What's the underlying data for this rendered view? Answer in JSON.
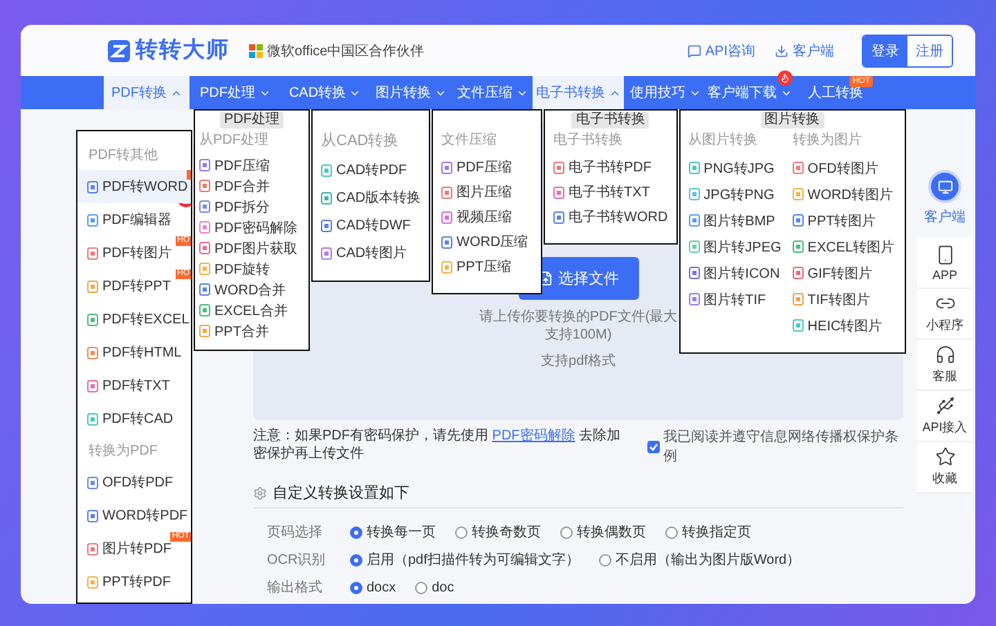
{
  "header": {
    "brand": "转转大师",
    "partner": "微软office中国区合作伙伴",
    "links": [
      {
        "label": "API咨询",
        "kind": "chat"
      },
      {
        "label": "客户端",
        "kind": "download"
      }
    ],
    "buttons": [
      {
        "label": "登录",
        "selected": true
      },
      {
        "label": "注册",
        "selected": false
      }
    ]
  },
  "nav": [
    {
      "label": "PDF转换",
      "kind": "menu",
      "selected": true,
      "expanded": true
    },
    {
      "label": "PDF处理",
      "kind": "menu",
      "selected": false,
      "expanded": false
    },
    {
      "label": "CAD转换",
      "kind": "menu",
      "selected": false,
      "expanded": false
    },
    {
      "label": "图片转换",
      "kind": "menu",
      "selected": false,
      "expanded": false
    },
    {
      "label": "文件压缩",
      "kind": "menu",
      "selected": false,
      "expanded": false
    },
    {
      "label": "电子书转换",
      "kind": "menu",
      "selected": true,
      "expanded": true
    },
    {
      "label": "使用技巧",
      "kind": "menu",
      "selected": false,
      "expanded": false
    },
    {
      "label": "客户端下载",
      "kind": "download",
      "selected": false,
      "expanded": false
    },
    {
      "label": "人工转换",
      "kind": "link",
      "selected": false,
      "badge": "HOT"
    }
  ],
  "menus": [
    {
      "kind": "side",
      "home_badge": true,
      "sections": [
        {
          "heading": "PDF转其他",
          "items": [
            {
              "label": "PDF转WORD",
              "color": "#5b83f0",
              "selected": true,
              "badge_sliver": true
            },
            {
              "label": "PDF编辑器",
              "color": "#5b9cf0",
              "selected": false
            },
            {
              "label": "PDF转图片",
              "color": "#f07a7a",
              "selected": false,
              "badge": "HO"
            },
            {
              "label": "PDF转PPT",
              "color": "#f5a84a",
              "selected": false,
              "badge": "HO"
            },
            {
              "label": "PDF转EXCEL",
              "color": "#4dbf7f",
              "selected": false
            },
            {
              "label": "PDF转HTML",
              "color": "#f58a5a",
              "selected": false
            },
            {
              "label": "PDF转TXT",
              "color": "#f06ab0",
              "selected": false
            },
            {
              "label": "PDF转CAD",
              "color": "#4cc7c0",
              "selected": false
            }
          ]
        },
        {
          "heading": "转换为PDF",
          "items": [
            {
              "label": "OFD转PDF",
              "color": "#6b8cf0",
              "selected": false
            },
            {
              "label": "WORD转PDF",
              "color": "#5b83f0",
              "selected": false
            },
            {
              "label": "图片转PDF",
              "color": "#f07a7a",
              "selected": false,
              "badge": "HOT"
            },
            {
              "label": "PPT转PDF",
              "color": "#f5b24a",
              "selected": false
            }
          ]
        }
      ]
    },
    {
      "kind": "compact",
      "tooltip": "PDF处理",
      "sections": [
        {
          "heading": "从PDF处理",
          "items": [
            {
              "label": "PDF压缩",
              "color": "#9a7cf0"
            },
            {
              "label": "PDF合并",
              "color": "#f07a6a"
            },
            {
              "label": "PDF拆分",
              "color": "#7a8cf0"
            },
            {
              "label": "PDF密码解除",
              "color": "#e08ad8"
            },
            {
              "label": "PDF图片获取",
              "color": "#f06a9a"
            },
            {
              "label": "PDF旋转",
              "color": "#f5b24a"
            },
            {
              "label": "WORD合并",
              "color": "#5b83f0"
            },
            {
              "label": "EXCEL合并",
              "color": "#4dbf7f"
            },
            {
              "label": "PPT合并",
              "color": "#f5a84a"
            }
          ]
        }
      ]
    },
    {
      "kind": "large",
      "sections": [
        {
          "heading": "从CAD转换",
          "items": [
            {
              "label": "CAD转PDF",
              "color": "#4cc7c0"
            },
            {
              "label": "CAD版本转换",
              "color": "#3fb8a8"
            },
            {
              "label": "CAD转DWF",
              "color": "#5b83f0"
            },
            {
              "label": "CAD转图片",
              "color": "#b07cf0"
            }
          ]
        }
      ]
    },
    {
      "kind": "regular",
      "sections": [
        {
          "heading": "文件压缩",
          "items": [
            {
              "label": "PDF压缩",
              "color": "#9a7cf0"
            },
            {
              "label": "图片压缩",
              "color": "#f07a7a"
            },
            {
              "label": "视频压缩",
              "color": "#e06ae0"
            },
            {
              "label": "WORD压缩",
              "color": "#5b83f0"
            },
            {
              "label": "PPT压缩",
              "color": "#f5b24a"
            }
          ]
        }
      ]
    },
    {
      "kind": "regular",
      "tooltip": "电子书转换",
      "sections": [
        {
          "heading": "电子书转换",
          "items": [
            {
              "label": "电子书转PDF",
              "color": "#f07a7a"
            },
            {
              "label": "电子书转TXT",
              "color": "#f06ab0"
            },
            {
              "label": "电子书转WORD",
              "color": "#5b83f0"
            }
          ]
        }
      ]
    },
    {
      "kind": "columns",
      "tooltip": "图片转换",
      "sections": [
        {
          "heading": "从图片转换",
          "items": [
            {
              "label": "PNG转JPG",
              "color": "#4cc7c0"
            },
            {
              "label": "JPG转PNG",
              "color": "#5bc7e0"
            },
            {
              "label": "图片转BMP",
              "color": "#5b9cf0"
            },
            {
              "label": "图片转JPEG",
              "color": "#6cd0b0"
            },
            {
              "label": "图片转ICON",
              "color": "#7a6cf0"
            },
            {
              "label": "图片转TIF",
              "color": "#a07cf0"
            }
          ]
        },
        {
          "heading": "转换为图片",
          "items": [
            {
              "label": "OFD转图片",
              "color": "#f07a7a"
            },
            {
              "label": "WORD转图片",
              "color": "#f5b24a"
            },
            {
              "label": "PPT转图片",
              "color": "#5b83f0"
            },
            {
              "label": "EXCEL转图片",
              "color": "#4dbf7f"
            },
            {
              "label": "GIF转图片",
              "color": "#f06a7a"
            },
            {
              "label": "TIF转图片",
              "color": "#f5a04a"
            },
            {
              "label": "HEIC转图片",
              "color": "#4cc7d0"
            }
          ]
        }
      ]
    }
  ],
  "upload": {
    "button": "选择文件",
    "hint": [
      "请上传你要转换的PDF文件(最大支持100M)",
      "支持pdf格式"
    ]
  },
  "note": {
    "before": "注意：如果PDF有密码保护，请先使用",
    "link": "PDF密码解除",
    "after": "去除加密保护再上传文件"
  },
  "agreement": {
    "label": "我已阅读并遵守信息网络传播权保护条例",
    "checked": true
  },
  "settings": {
    "title": "自定义转换设置如下",
    "rows": [
      {
        "label": "页码选择",
        "options": [
          {
            "label": "转换每一页",
            "selected": true
          },
          {
            "label": "转换奇数页",
            "selected": false
          },
          {
            "label": "转换偶数页",
            "selected": false
          },
          {
            "label": "转换指定页",
            "selected": false
          }
        ]
      },
      {
        "label": "OCR识别",
        "options": [
          {
            "label": "启用（pdf扫描件转为可编辑文字）",
            "selected": true
          },
          {
            "label": "不启用（输出为图片版Word）",
            "selected": false
          }
        ]
      },
      {
        "label": "输出格式",
        "options": [
          {
            "label": "docx",
            "selected": true
          },
          {
            "label": "doc",
            "selected": false
          }
        ]
      }
    ]
  },
  "sidebar": {
    "client": "客户端",
    "items": [
      {
        "label": "APP",
        "kind": "phone"
      },
      {
        "label": "小程序",
        "kind": "link"
      },
      {
        "label": "客服",
        "kind": "headset"
      },
      {
        "label": "API接入",
        "kind": "api"
      },
      {
        "label": "收藏",
        "kind": "star"
      }
    ]
  }
}
